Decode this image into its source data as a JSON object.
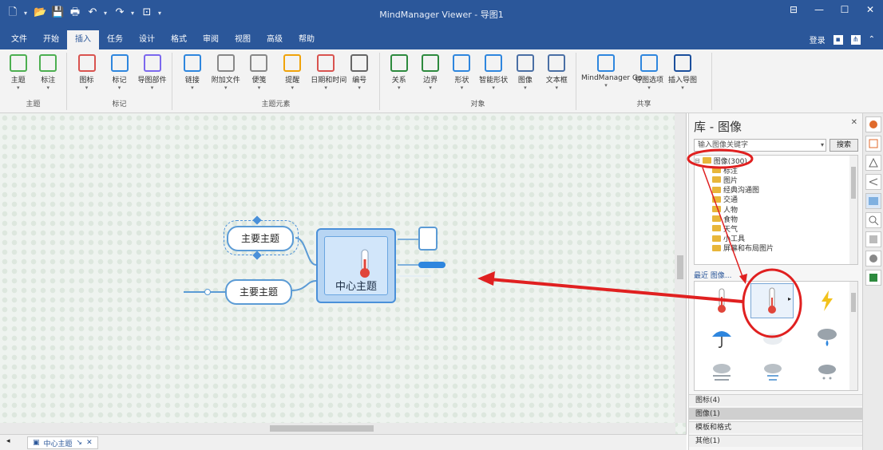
{
  "app": {
    "title": "MindManager Viewer - 导图1"
  },
  "qat": {
    "icons": [
      "new-icon",
      "open-icon",
      "save-icon",
      "print-icon",
      "undo-icon",
      "redo-icon",
      "customize-icon"
    ]
  },
  "tabs": [
    "文件",
    "开始",
    "插入",
    "任务",
    "设计",
    "格式",
    "审阅",
    "视图",
    "高级",
    "帮助"
  ],
  "active_tab": "插入",
  "tab_right": {
    "label": "登录"
  },
  "ribbon_groups": [
    {
      "label": "主题",
      "buttons": [
        "主题",
        "标注"
      ]
    },
    {
      "label": "标记",
      "buttons": [
        "图标",
        "标记",
        "导图部件"
      ]
    },
    {
      "label": "主题元素",
      "buttons": [
        "链接",
        "附加文件",
        "便笺",
        "提醒",
        "日期和时间",
        "编号"
      ]
    },
    {
      "label": "对象",
      "buttons": [
        "关系",
        "边界",
        "形状",
        "智能形状",
        "图像",
        "文本框"
      ]
    },
    {
      "label": "共享",
      "buttons": [
        "MindManager Go",
        "导图选项",
        "插入导图"
      ]
    }
  ],
  "canvas": {
    "central_topic": "中心主题",
    "main_topics": [
      "主要主题",
      "主要主题"
    ]
  },
  "statusbar": {
    "doc_tab": "中心主题"
  },
  "panel": {
    "title": "库 - 图像",
    "search_placeholder": "输入图像关键字",
    "search_button": "搜索",
    "tree_root": "图像(300)",
    "tree_items": [
      "标注",
      "图片",
      "经典沟通图",
      "交通",
      "人物",
      "食物",
      "天气",
      "小工具",
      "屏幕和布局图片"
    ],
    "recent_label": "最近 图像...",
    "accordion": [
      "图标(4)",
      "图像(1)",
      "模板和格式",
      "其他(1)"
    ],
    "active_accordion": "图像(1)"
  },
  "colors": {
    "accent": "#2b579a",
    "topic_border": "#5b9bd5",
    "central_fill": "#b7d5f3",
    "highlight": "#e02020"
  }
}
